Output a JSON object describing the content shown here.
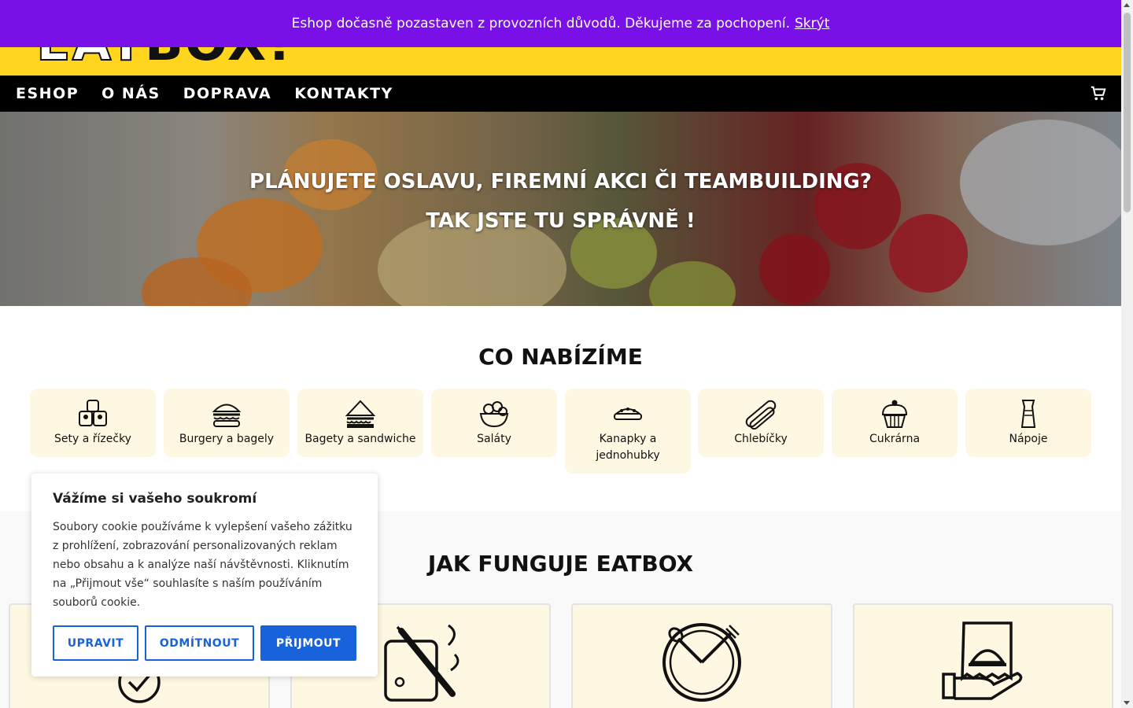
{
  "notice": {
    "text": "Eshop dočasně pozastaven z provozních důvodů. Děkujeme za pochopení.",
    "hide_link": "Skrýt"
  },
  "header": {
    "logo_part1": "EAT",
    "logo_part2": "BOX!"
  },
  "nav": {
    "items": [
      "ESHOP",
      "O NÁS",
      "DOPRAVA",
      "KONTAKTY"
    ],
    "cart_icon": "cart-icon"
  },
  "hero": {
    "line1": "PLÁNUJETE OSLAVU, FIREMNÍ AKCI ČI TEAMBUILDING?",
    "line2": "TAK JSTE TU SPRÁVNĚ !"
  },
  "offer": {
    "title": "CO NABÍZÍME",
    "categories": [
      {
        "label": "Sety a řízečky",
        "icon": "sushi-rolls-icon"
      },
      {
        "label": "Burgery a bagely",
        "icon": "burger-icon"
      },
      {
        "label": "Bagety a sandwiche",
        "icon": "sandwich-icon"
      },
      {
        "label": "Saláty",
        "icon": "salad-bowl-icon"
      },
      {
        "label": "Kanapky a jednohubky",
        "icon": "canape-icon"
      },
      {
        "label": "Chlebíčky",
        "icon": "bread-icon"
      },
      {
        "label": "Cukrárna",
        "icon": "cupcake-icon"
      },
      {
        "label": "Nápoje",
        "icon": "drink-icon"
      }
    ]
  },
  "how": {
    "title": "JAK FUNGUJE EATBOX",
    "steps": [
      {
        "icon": "checkmark-icon"
      },
      {
        "icon": "cutting-board-icon"
      },
      {
        "icon": "clock-fork-icon"
      },
      {
        "icon": "delivery-dish-icon"
      }
    ]
  },
  "cookie": {
    "title": "Vážíme si vašeho soukromí",
    "text": "Soubory cookie používáme k vylepšení vašeho zážitku z prohlížení, zobrazování personalizovaných reklam nebo obsahu a k analýze naší návštěvnosti. Kliknutím na „Přijmout vše“ souhlasíte s naším používáním souborů cookie.",
    "buttons": {
      "customize": "UPRAVIT",
      "reject": "ODMÍTNOUT",
      "accept": "PŘIJMOUT"
    }
  },
  "colors": {
    "notice_bg": "#7a10e8",
    "header_bg": "#ffd51f",
    "nav_bg": "#000000",
    "card_bg": "#fef8e2",
    "cookie_accent": "#1863dc"
  }
}
